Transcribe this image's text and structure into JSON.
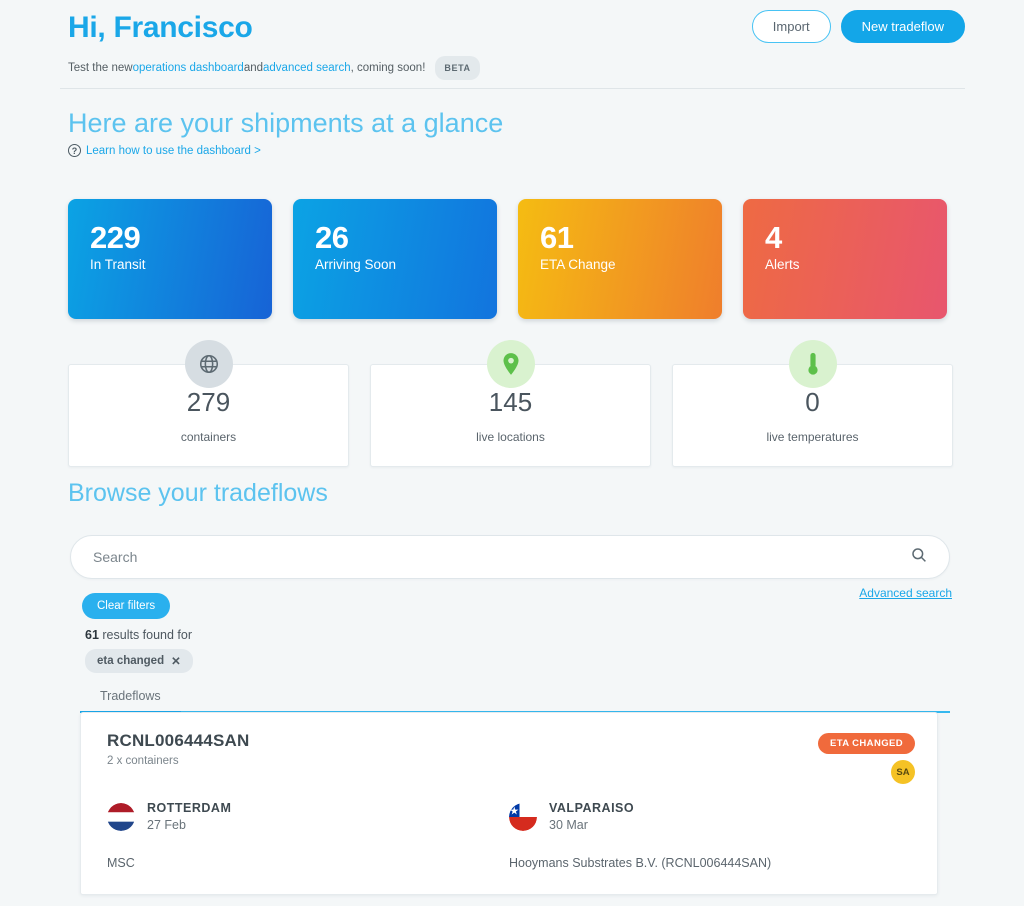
{
  "header": {
    "greeting": "Hi, Francisco",
    "subline_pre": "Test the new ",
    "link_operations": "operations dashboard",
    "subline_mid": " and ",
    "link_advanced": "advanced search",
    "subline_post": ", coming soon!",
    "beta_badge": "BETA",
    "import_label": "Import",
    "new_tradeflow_label": "New tradeflow"
  },
  "glance": {
    "title": "Here are your shipments at a glance",
    "learn_link": "Learn how to use the dashboard >",
    "help_icon": "question-circle-icon",
    "kpis": [
      {
        "value": "229",
        "label": "In Transit",
        "color_from": "#0ba3e4",
        "color_to": "#1763d6"
      },
      {
        "value": "26",
        "label": "Arriving Soon",
        "color_from": "#0ba3e4",
        "color_to": "#1274de"
      },
      {
        "value": "61",
        "label": "ETA Change",
        "color_from": "#f5bc12",
        "color_to": "#ef7e2c"
      },
      {
        "value": "4",
        "label": "Alerts",
        "color_from": "#ee6a43",
        "color_to": "#e8566e"
      }
    ],
    "stats": [
      {
        "value": "279",
        "label": "containers",
        "icon": "globe-icon",
        "badge_bg": "#d6dde2",
        "icon_color": "#5d6a72"
      },
      {
        "value": "145",
        "label": "live locations",
        "icon": "map-pin-icon",
        "badge_bg": "#d9f2cf",
        "icon_color": "#5dc04a"
      },
      {
        "value": "0",
        "label": "live temperatures",
        "icon": "thermometer-icon",
        "badge_bg": "#d9f2cf",
        "icon_color": "#5dc04a"
      }
    ]
  },
  "browse": {
    "title": "Browse your tradeflows",
    "search_placeholder": "Search",
    "search_value": "",
    "search_icon": "search-icon",
    "advanced_search_label": "Advanced search",
    "clear_filters_label": "Clear filters",
    "results_count": "61",
    "results_suffix": " results found for",
    "filter_chip": "eta changed",
    "filter_chip_remove": "✕",
    "tabs": [
      {
        "label": "Tradeflows",
        "active": true
      }
    ]
  },
  "result": {
    "reference": "RCNL006444SAN",
    "containers": "2 x containers",
    "status_badge": "ETA CHANGED",
    "avatar_initials": "SA",
    "origin": {
      "port": "ROTTERDAM",
      "date": "27 Feb",
      "flag": "netherlands-flag-icon",
      "carrier": "MSC"
    },
    "destination": {
      "port": "VALPARAISO",
      "date": "30 Mar",
      "flag": "chile-flag-icon",
      "consignee": "Hooymans Substrates B.V. (RCNL006444SAN)"
    }
  }
}
